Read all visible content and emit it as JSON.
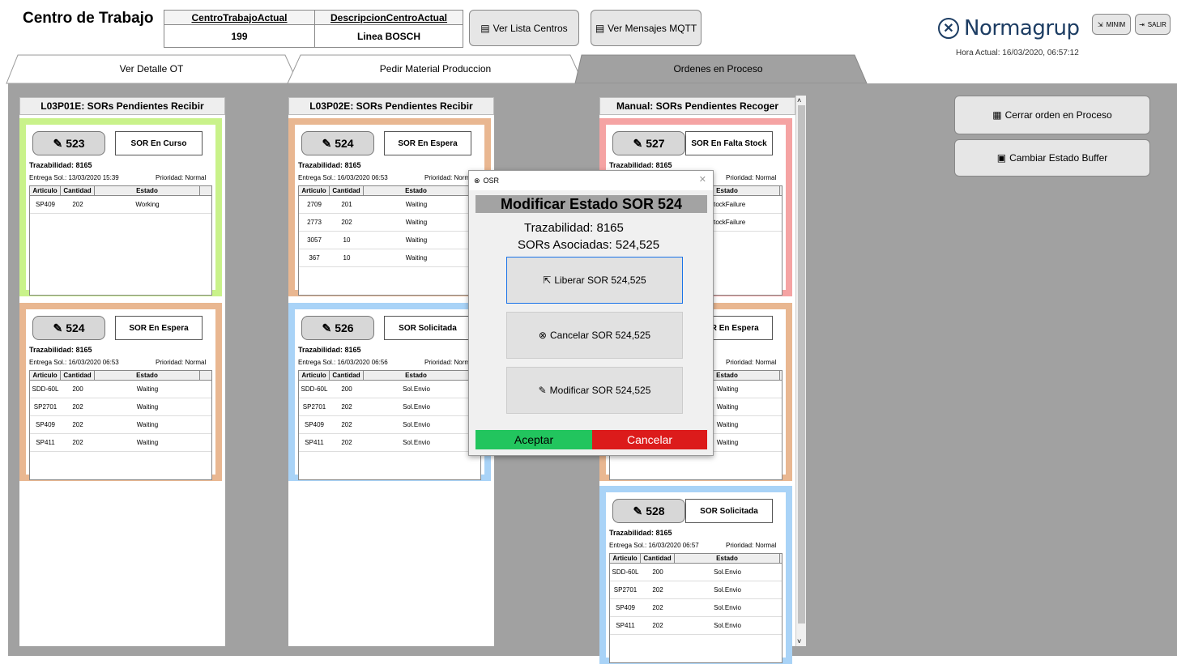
{
  "app": {
    "title": "Centro de Trabajo",
    "hora": "Hora Actual: 16/03/2020, 06:57:12",
    "logo": "Normagrup"
  },
  "header_table": {
    "h1": "CentroTrabajoActual",
    "h2": "DescripcionCentroActual",
    "v1": "199",
    "v2": "Linea BOSCH"
  },
  "buttons": {
    "lista": "Ver Lista Centros",
    "mqtt": "Ver Mensajes MQTT",
    "minim": "MINIM",
    "salir": "SALIR",
    "cerrar": "Cerrar orden en Proceso",
    "buffer": "Cambiar Estado Buffer"
  },
  "tabs": [
    "Ver Detalle OT",
    "Pedir Material Produccion",
    "Ordenes en  Proceso"
  ],
  "panels": [
    {
      "title": "L03P01E: SORs Pendientes Recibir",
      "cards": [
        {
          "num": "523",
          "estado": "SOR En Curso",
          "color": "#c9f28a",
          "trz": "Trazabilidad: 8165",
          "ent": "Entrega Sol.: 13/03/2020 15:39",
          "prio": "Prioridad: Normal",
          "rows": [
            [
              "SP409",
              "202",
              "Working"
            ]
          ]
        },
        {
          "num": "524",
          "estado": "SOR En Espera",
          "color": "#e9b791",
          "trz": "Trazabilidad: 8165",
          "ent": "Entrega Sol.: 16/03/2020 06:53",
          "prio": "Prioridad: Normal",
          "rows": [
            [
              "SDD-60L",
              "200",
              "Waiting"
            ],
            [
              "SP2701",
              "202",
              "Waiting"
            ],
            [
              "SP409",
              "202",
              "Waiting"
            ],
            [
              "SP411",
              "202",
              "Waiting"
            ]
          ]
        }
      ]
    },
    {
      "title": "L03P02E: SORs Pendientes Recibir",
      "cards": [
        {
          "num": "524",
          "estado": "SOR En Espera",
          "color": "#e9b791",
          "trz": "Trazabilidad: 8165",
          "ent": "Entrega Sol.: 16/03/2020 06:53",
          "prio": "Prioridad: Normal",
          "rows": [
            [
              "2709",
              "201",
              "Waiting"
            ],
            [
              "2773",
              "202",
              "Waiting"
            ],
            [
              "3057",
              "10",
              "Waiting"
            ],
            [
              "367",
              "10",
              "Waiting"
            ]
          ]
        },
        {
          "num": "526",
          "estado": "SOR Solicitada",
          "color": "#a9d3f7",
          "trz": "Trazabilidad: 8165",
          "ent": "Entrega Sol.: 16/03/2020 06:56",
          "prio": "Prioridad: Normal",
          "rows": [
            [
              "SDD-60L",
              "200",
              "Sol.Envio"
            ],
            [
              "SP2701",
              "202",
              "Sol.Envio"
            ],
            [
              "SP409",
              "202",
              "Sol.Envio"
            ],
            [
              "SP411",
              "202",
              "Sol.Envio"
            ]
          ]
        }
      ]
    },
    {
      "title": "Manual: SORs Pendientes Recoger",
      "cards": [
        {
          "num": "527",
          "estado": "SOR En Falta Stock",
          "color": "#f5a3a3",
          "trz": "Trazabilidad: 8165",
          "ent": "",
          "prio": "Prioridad: Normal",
          "rows": [
            [
              "",
              "",
              "StockFailure"
            ],
            [
              "",
              "",
              "StockFailure"
            ]
          ]
        },
        {
          "num": "",
          "estado": "SOR En Espera",
          "color": "#e9b791",
          "trz": "",
          "ent": "",
          "prio": "Prioridad: Normal",
          "rows": [
            [
              "",
              "",
              "Waiting"
            ],
            [
              "",
              "",
              "Waiting"
            ],
            [
              "",
              "",
              "Waiting"
            ],
            [
              "",
              "",
              "Waiting"
            ]
          ]
        },
        {
          "num": "528",
          "estado": "SOR Solicitada",
          "color": "#a9d3f7",
          "trz": "Trazabilidad: 8165",
          "ent": "Entrega Sol.: 16/03/2020 06:57",
          "prio": "Prioridad: Normal",
          "rows": [
            [
              "SDD-60L",
              "200",
              "Sol.Envio"
            ],
            [
              "SP2701",
              "202",
              "Sol.Envio"
            ],
            [
              "SP409",
              "202",
              "Sol.Envio"
            ],
            [
              "SP411",
              "202",
              "Sol.Envio"
            ]
          ]
        }
      ]
    }
  ],
  "table_headers": [
    "Articulo",
    "Cantidad",
    "Estado"
  ],
  "dialog": {
    "window": "OSR",
    "title": "Modificar Estado SOR 524",
    "trz": "Trazabilidad: 8165",
    "asoc": "SORs Asociadas: 524,525",
    "liberar": "Liberar SOR 524,525",
    "cancelar": "Cancelar SOR 524,525",
    "modificar": "Modificar SOR 524,525",
    "aceptar": "Aceptar",
    "cancel_btn": "Cancelar"
  }
}
